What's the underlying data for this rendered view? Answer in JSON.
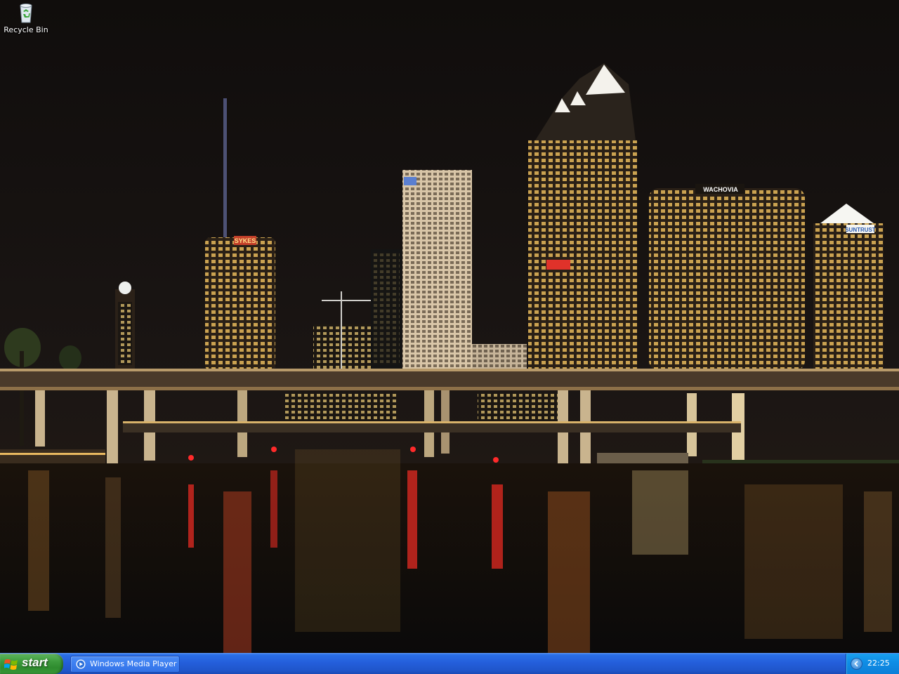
{
  "desktop": {
    "icons": [
      {
        "label": "Recycle Bin",
        "icon": "recycle-bin-icon"
      }
    ],
    "wallpaper": {
      "description_icon": "city-night-skyline",
      "signs": {
        "sykes": "SYKES",
        "wachovia": "WACHOVIA",
        "suntrust": "SUNTRUST"
      }
    }
  },
  "taskbar": {
    "start_label": "start",
    "tasks": [
      {
        "label": "Windows Media Player",
        "icon": "windows-media-player-icon"
      }
    ],
    "tray": {
      "time": "22:25",
      "expand_icon": "chevron-left-icon"
    },
    "colors": {
      "taskbar": "#245edb",
      "start": "#3c9a3c",
      "tray": "#0f8ee6"
    }
  }
}
